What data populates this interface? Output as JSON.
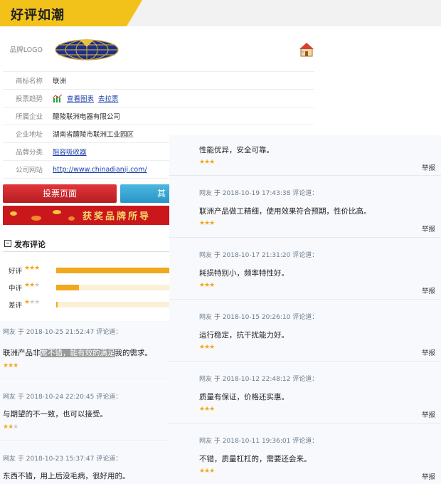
{
  "header": {
    "title": "好评如潮"
  },
  "info": {
    "logo_label": "品牌LOGO",
    "rows": [
      {
        "label": "商标名称",
        "value": "联洲"
      },
      {
        "label": "投票趋势",
        "link1": "查看图表",
        "link2": "去拉票"
      },
      {
        "label": "所属企业",
        "value": "醴陵联洲电器有限公司"
      },
      {
        "label": "企业地址",
        "value": "湖南省醴陵市联洲工业园区"
      },
      {
        "label": "品牌分类",
        "value": "阻容吸收器"
      },
      {
        "label": "公司网站",
        "value": "http://www.chinadianji.com/"
      }
    ]
  },
  "buttons": {
    "vote": "投票页面",
    "other": "其"
  },
  "banner": {
    "text": "获奖品牌所导"
  },
  "ratings": {
    "title": "发布评论",
    "rows": [
      {
        "label": "好评",
        "stars": 3,
        "fill": 1.0
      },
      {
        "label": "中评",
        "stars": 2,
        "fill": 0.2
      },
      {
        "label": "差评",
        "stars": 1,
        "fill": 0.01
      }
    ]
  },
  "left_comments": [
    {
      "user": "网友",
      "yu": "于",
      "date": "2018-10-25 21:52:47",
      "said": "评论道：",
      "text_a": "联洲产品非",
      "text_hl": "常不错，能有效的满足",
      "text_b": "我的需求。",
      "stars": 3
    },
    {
      "user": "网友",
      "yu": "于",
      "date": "2018-10-24 22:20:45",
      "said": "评论道：",
      "text": "与期望的不一致，也可以接受。",
      "stars": 2
    },
    {
      "user": "网友",
      "yu": "于",
      "date": "2018-10-23 15:37:47",
      "said": "评论道：",
      "text": "东西不错，用上后没毛病，很好用的。"
    }
  ],
  "right_first": {
    "text": "性能优异，安全可靠。",
    "stars": 3,
    "report": "举报"
  },
  "right_comments": [
    {
      "user": "网友",
      "yu": "于",
      "date": "2018-10-19 17:43:38",
      "said": "评论道：",
      "text": "联洲产品做工精细，使用效果符合预期，性价比高。",
      "stars": 3,
      "report": "举报"
    },
    {
      "user": "网友",
      "yu": "于",
      "date": "2018-10-17 21:31:20",
      "said": "评论道：",
      "text": "耗损特别小，频率特性好。",
      "stars": 3,
      "report": "举报"
    },
    {
      "user": "网友",
      "yu": "于",
      "date": "2018-10-15 20:26:10",
      "said": "评论道：",
      "text": "运行稳定，抗干扰能力好。",
      "stars": 3,
      "report": "举报"
    },
    {
      "user": "网友",
      "yu": "于",
      "date": "2018-10-12 22:48:12",
      "said": "评论道：",
      "text": "质量有保证，价格还实惠。",
      "stars": 3,
      "report": "举报"
    },
    {
      "user": "网友",
      "yu": "于",
      "date": "2018-10-11 19:36:01",
      "said": "评论道：",
      "text": "不错，质量杠杠的，需要还会来。",
      "stars": 3,
      "report": "举报"
    }
  ],
  "colors": {
    "accent_yellow": "#f2c21a",
    "vote_red": "#c9171c",
    "star_orange": "#f2a81d",
    "link_blue": "#1a3fa8"
  }
}
